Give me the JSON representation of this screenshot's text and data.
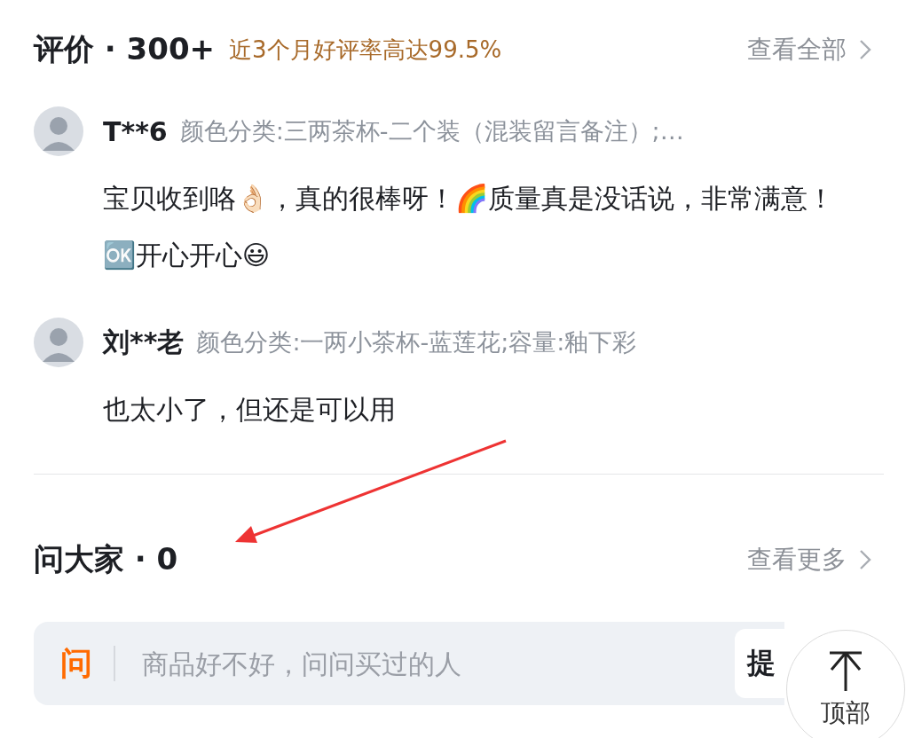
{
  "reviews_section": {
    "title": "评价 · 300+",
    "rating_note": "近3个月好评率高达99.5%",
    "view_all": "查看全部"
  },
  "reviews": [
    {
      "user": "T**6",
      "spec": "颜色分类:三两茶杯-二个装（混装留言备注）;…",
      "text": "宝贝收到咯👌🏻，真的很棒呀！🌈质量真是没话说，非常满意！🆗开心开心😃"
    },
    {
      "user": "刘**老",
      "spec": "颜色分类:一两小茶杯-蓝莲花;容量:釉下彩",
      "text": "也太小了，但还是可以用"
    }
  ],
  "ask_section": {
    "title": "问大家 · 0",
    "view_more": "查看更多",
    "input_icon": "问",
    "placeholder": "商品好不好，问问买过的人",
    "ask_button": "提"
  },
  "back_to_top": "顶部"
}
